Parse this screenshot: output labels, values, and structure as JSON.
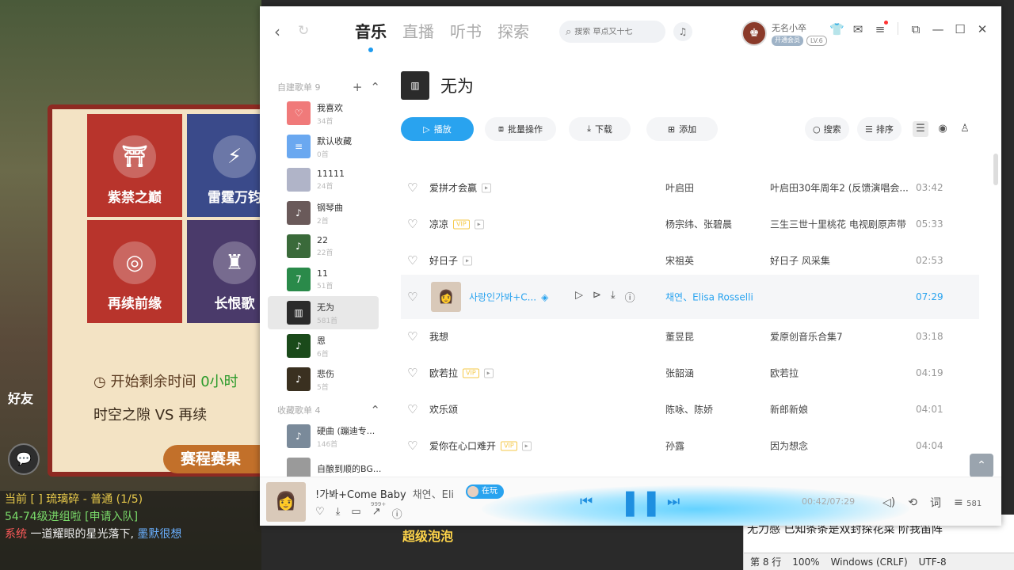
{
  "background_game": {
    "tiles": [
      "紫禁之巅",
      "雷霆万钧",
      "再续前缘",
      "长恨歌"
    ],
    "timer_label": "开始剩余时间",
    "timer_value": "0小时",
    "vs_left": "时空之隙",
    "vs_text": "VS",
    "vs_right": "再续",
    "schedule_button": "赛程赛果",
    "friends": "好友",
    "chat_lines": [
      "当前 [  ] 琉璃碎 - 普通 (1/5)",
      "54-74级进组啦 [申请入队]",
      {
        "prefix": "系统",
        "text": "一道耀眼的星光落下,",
        "name": "墨默很想"
      }
    ]
  },
  "background_overlay_label": "超级泡泡",
  "background_editor": {
    "line": "无力感    已知条条是双封探花菜 阶我笛阵",
    "status": [
      "第 8 行",
      "100%",
      "Windows (CRLF)",
      "UTF-8"
    ]
  },
  "app": {
    "main_tabs": [
      "音乐",
      "直播",
      "听书",
      "探索"
    ],
    "active_tab": 0,
    "search_placeholder": "搜索 草点又十七",
    "user": {
      "name": "无名小卒",
      "vip": "开通会员",
      "level": "LV.6"
    },
    "sidebar": {
      "created_header": "自建歌单 9",
      "created": [
        {
          "name": "我喜欢",
          "count": "34首",
          "color": "#f07a7a",
          "icon": "♡"
        },
        {
          "name": "默认收藏",
          "count": "0首",
          "color": "#6aa8f0",
          "icon": "≡"
        },
        {
          "name": "11111",
          "count": "24首",
          "color": "#b0b4c8",
          "icon": ""
        },
        {
          "name": "钢琴曲",
          "count": "2首",
          "color": "#6a5a5a",
          "icon": "♪"
        },
        {
          "name": "22",
          "count": "22首",
          "color": "#3a6a3a",
          "icon": "♪"
        },
        {
          "name": "11",
          "count": "51首",
          "color": "#2a8a4a",
          "icon": "7"
        },
        {
          "name": "无为",
          "count": "581首",
          "color": "#2b2b2b",
          "icon": "▥"
        },
        {
          "name": "恩",
          "count": "6首",
          "color": "#1a4a1a",
          "icon": "♪"
        },
        {
          "name": "悲伤",
          "count": "5首",
          "color": "#3a3020",
          "icon": "♪"
        }
      ],
      "active_index": 6,
      "collected_header": "收藏歌单 4",
      "collected": [
        {
          "name": "硬曲 (蹦迪专...",
          "count": "146首",
          "color": "#7a8a9a",
          "icon": "♪"
        },
        {
          "name": "自酿到顺的BG...",
          "count": "",
          "color": "#9a9a9a",
          "icon": ""
        }
      ]
    },
    "playlist": {
      "title": "无为",
      "toolbar": {
        "play": "播放",
        "batch": "批量操作",
        "download": "下载",
        "add": "添加",
        "search": "搜索",
        "sort": "排序"
      },
      "songs": [
        {
          "title": "爱拼才会赢",
          "tags": [
            "mv"
          ],
          "artist": "叶启田",
          "album": "叶启田30年周年2 (反馈演唱会...",
          "duration": "03:42"
        },
        {
          "title": "凉凉",
          "tags": [
            "vip",
            "mv"
          ],
          "artist": "杨宗纬、张碧晨",
          "album": "三生三世十里桃花 电视剧原声带",
          "duration": "05:33"
        },
        {
          "title": "好日子",
          "tags": [
            "mv"
          ],
          "artist": "宋祖英",
          "album": "好日子 风采集",
          "duration": "02:53"
        },
        {
          "title": "사랑인가봐+C...",
          "tags": [],
          "artist": "채연、Elisa Rosselli",
          "album": "",
          "duration": "07:29",
          "hover": true
        },
        {
          "title": "我想",
          "tags": [],
          "artist": "董昱昆",
          "album": "爱原创音乐合集7",
          "duration": "03:18"
        },
        {
          "title": "欧若拉",
          "tags": [
            "vip",
            "mv"
          ],
          "artist": "张韶涵",
          "album": "欧若拉",
          "duration": "04:19"
        },
        {
          "title": "欢乐颂",
          "tags": [],
          "artist": "陈咏、陈娇",
          "album": "新郎新娘",
          "duration": "04:01"
        },
        {
          "title": "爱你在心口难开",
          "tags": [
            "vip",
            "mv"
          ],
          "artist": "孙露",
          "album": "因为想念",
          "duration": "04:04"
        }
      ]
    },
    "player": {
      "title": "!가봐+Come Baby",
      "artist": "채연、Eli",
      "badge": "在玩",
      "comment_count": "999+",
      "time": "00:42/07:29",
      "lyrics_label": "词",
      "playlist_count": "581"
    },
    "colors": {
      "accent": "#29a3ef",
      "vip": "#f5c94a"
    }
  }
}
